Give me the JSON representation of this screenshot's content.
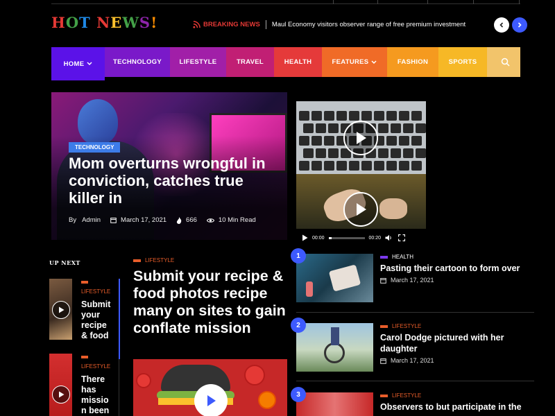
{
  "logo": {
    "letters": [
      "H",
      "O",
      "T",
      " ",
      "N",
      "E",
      "W",
      "S",
      "!"
    ],
    "colors": [
      "#e53935",
      "#43a047",
      "#1e88e5",
      "#000000",
      "#e53935",
      "#fbc02d",
      "#43a047",
      "#8e24aa",
      "#fb8c00"
    ]
  },
  "breaking": {
    "label": "BREAKING NEWS",
    "headline": "Maul Economy visitors observer range of free premium investment",
    "icon": "rss-icon"
  },
  "slider": {
    "prev_icon": "chevron-left-icon",
    "next_icon": "chevron-right-icon"
  },
  "nav": {
    "items": [
      {
        "label": "HOME",
        "color": "#5b12e8",
        "has_dropdown": true
      },
      {
        "label": "TECHNOLOGY",
        "color": "#7a19c9",
        "has_dropdown": false
      },
      {
        "label": "LIFESTYLE",
        "color": "#a11fa8",
        "has_dropdown": false
      },
      {
        "label": "TRAVEL",
        "color": "#c11f74",
        "has_dropdown": false
      },
      {
        "label": "HEALTH",
        "color": "#e53a3a",
        "has_dropdown": false
      },
      {
        "label": "FEATURES",
        "color": "#f06b27",
        "has_dropdown": true
      },
      {
        "label": "FASHION",
        "color": "#f59a1f",
        "has_dropdown": false
      },
      {
        "label": "SPORTS",
        "color": "#f6b826",
        "has_dropdown": false
      }
    ],
    "search_color": "#f2c46b",
    "search_icon": "search-icon"
  },
  "hero": {
    "tag": "TECHNOLOGY",
    "title": "Mom overturns wrongful in conviction, catches true killer in",
    "author_prefix": "By",
    "author": "Admin",
    "date": "March 17, 2021",
    "likes": "666",
    "read_time": "10 Min Read"
  },
  "video": {
    "current_time": "00:00",
    "duration": "00:20",
    "progress": 0.08
  },
  "up_next": {
    "title": "UP NEXT",
    "items": [
      {
        "category": "LIFESTYLE",
        "title": "Submit your recipe & food"
      },
      {
        "category": "LIFESTYLE",
        "title": "There has missio n been"
      }
    ]
  },
  "featured": {
    "category": "LIFESTYLE",
    "title": "Submit your recipe & food photos recipe many on sites to gain conflate mission"
  },
  "side_list": [
    {
      "number": "1",
      "category": "HEALTH",
      "category_color": "#7c3aed",
      "title": "Pasting their cartoon to form over",
      "date": "March 17, 2021"
    },
    {
      "number": "2",
      "category": "LIFESTYLE",
      "category_color": "#e85d2a",
      "title": "Carol Dodge pictured with her daughter",
      "date": "March 17, 2021"
    },
    {
      "number": "3",
      "category": "LIFESTYLE",
      "category_color": "#e85d2a",
      "title": "Observers to but participate in the",
      "date": ""
    }
  ]
}
